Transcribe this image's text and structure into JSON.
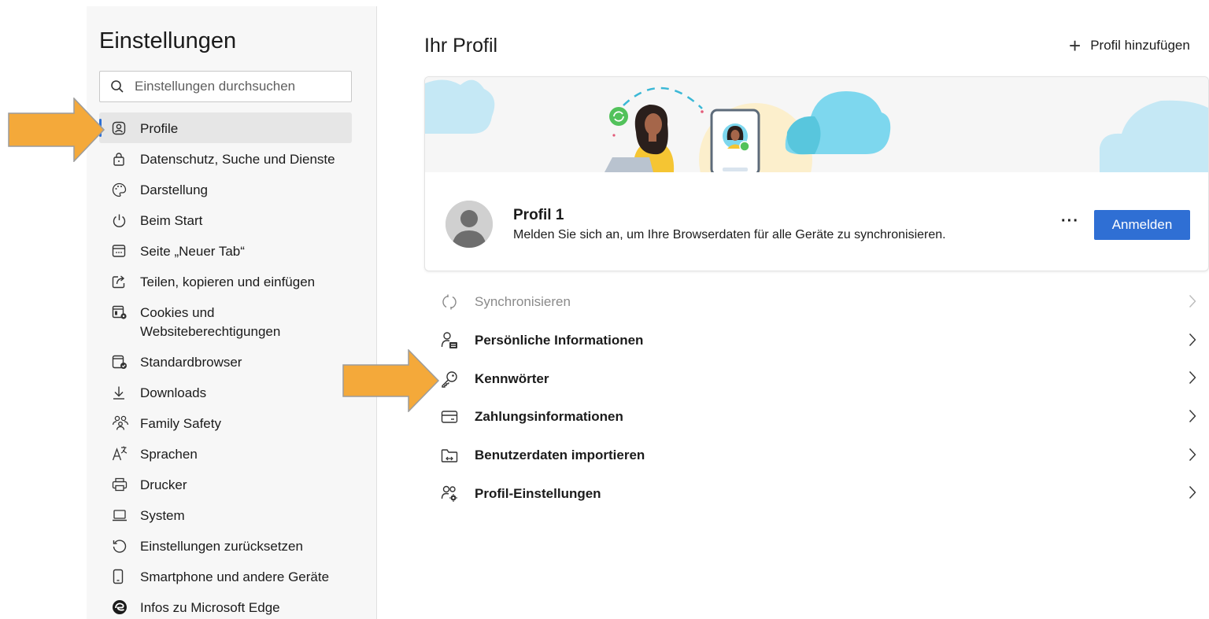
{
  "sidebar": {
    "title": "Einstellungen",
    "search_placeholder": "Einstellungen durchsuchen",
    "items": [
      {
        "label": "Profile",
        "icon": "profile-icon"
      },
      {
        "label": "Datenschutz, Suche und Dienste",
        "icon": "lock-icon"
      },
      {
        "label": "Darstellung",
        "icon": "palette-icon"
      },
      {
        "label": "Beim Start",
        "icon": "power-icon"
      },
      {
        "label": "Seite „Neuer Tab“",
        "icon": "new-tab-icon"
      },
      {
        "label": "Teilen, kopieren und einfügen",
        "icon": "share-icon"
      },
      {
        "label": "Cookies und Websiteberechtigungen",
        "icon": "cookies-icon"
      },
      {
        "label": "Standardbrowser",
        "icon": "default-browser-icon"
      },
      {
        "label": "Downloads",
        "icon": "download-icon"
      },
      {
        "label": "Family Safety",
        "icon": "family-icon"
      },
      {
        "label": "Sprachen",
        "icon": "language-icon"
      },
      {
        "label": "Drucker",
        "icon": "printer-icon"
      },
      {
        "label": "System",
        "icon": "laptop-icon"
      },
      {
        "label": "Einstellungen zurücksetzen",
        "icon": "reset-icon"
      },
      {
        "label": "Smartphone und andere Geräte",
        "icon": "phone-icon"
      },
      {
        "label": "Infos zu Microsoft Edge",
        "icon": "edge-icon"
      }
    ]
  },
  "main": {
    "title": "Ihr Profil",
    "add_profile_label": "Profil hinzufügen",
    "profile": {
      "name": "Profil 1",
      "description": "Melden Sie sich an, um Ihre Browserdaten für alle Geräte zu synchronisieren.",
      "more_label": "···",
      "signin_label": "Anmelden"
    },
    "rows": [
      {
        "label": "Synchronisieren",
        "icon": "sync-icon",
        "disabled": true
      },
      {
        "label": "Persönliche Informationen",
        "icon": "personal-info-icon"
      },
      {
        "label": "Kennwörter",
        "icon": "key-icon"
      },
      {
        "label": "Zahlungsinformationen",
        "icon": "card-icon"
      },
      {
        "label": "Benutzerdaten importieren",
        "icon": "import-icon"
      },
      {
        "label": "Profil-Einstellungen",
        "icon": "profile-settings-icon"
      }
    ]
  },
  "colors": {
    "accent": "#2f6fd4",
    "annotation_arrow": "#f4a93a"
  }
}
